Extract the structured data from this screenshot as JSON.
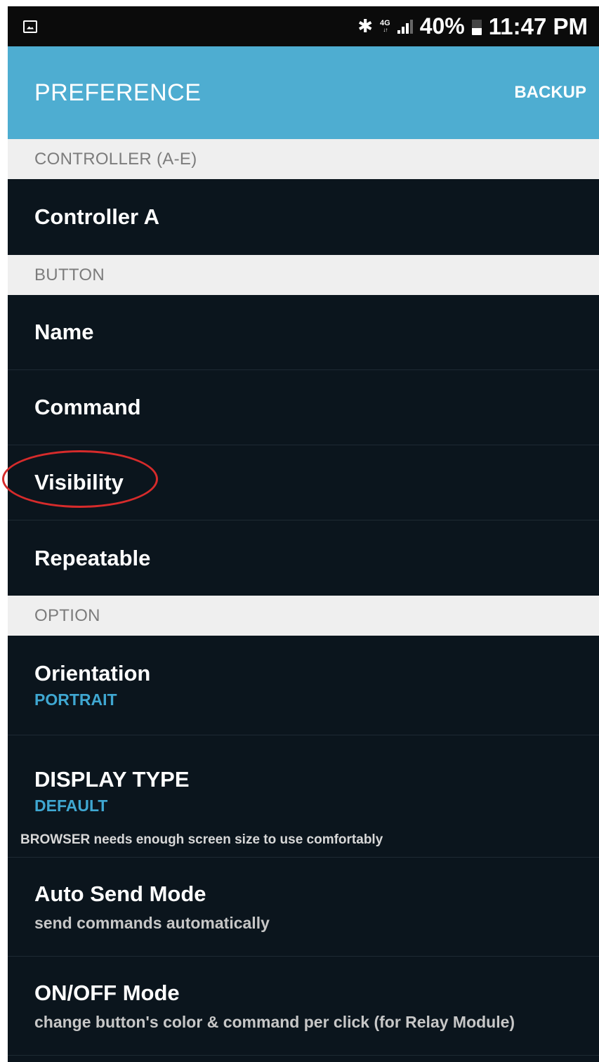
{
  "status_bar": {
    "bluetooth_icon": "bluetooth-icon",
    "network": "4G",
    "battery_percent": "40%",
    "time": "11:47 PM"
  },
  "action_bar": {
    "title": "PREFERENCE",
    "action": "BACKUP"
  },
  "sections": {
    "controller": {
      "header": "CONTROLLER (A-E)",
      "items": [
        {
          "title": "Controller A"
        }
      ]
    },
    "button": {
      "header": "BUTTON",
      "items": [
        {
          "title": "Name"
        },
        {
          "title": "Command"
        },
        {
          "title": "Visibility"
        },
        {
          "title": "Repeatable"
        }
      ]
    },
    "option": {
      "header": "OPTION",
      "items": [
        {
          "title": "Orientation",
          "summary": "PORTRAIT"
        },
        {
          "title": "DISPLAY TYPE",
          "summary": "DEFAULT"
        },
        {
          "title": "Auto Send Mode",
          "summary": "send commands automatically"
        },
        {
          "title": "ON/OFF Mode",
          "summary": "change button's color & command per click (for Relay Module)"
        }
      ],
      "display_note": "BROWSER needs enough screen size to use comfortably"
    }
  },
  "colors": {
    "accent": "#4eadd1",
    "background": "#0b151d",
    "summary_blue": "#3fa7d1",
    "highlight": "#d62b2b"
  }
}
